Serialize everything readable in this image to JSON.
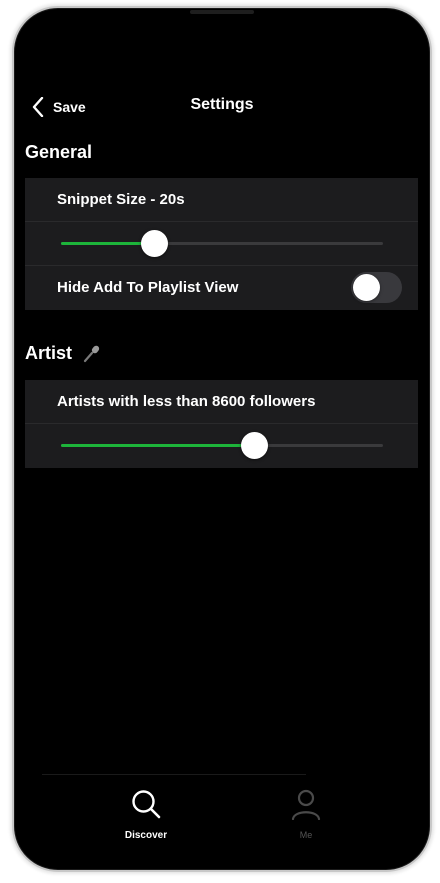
{
  "header": {
    "back_label": "Save",
    "title": "Settings"
  },
  "sections": {
    "general": {
      "title": "General",
      "snippet_size_label": "Snippet Size  -  20s",
      "snippet_slider_fraction": 0.29,
      "hide_playlist_label": "Hide Add To Playlist View",
      "hide_playlist_on": false
    },
    "artist": {
      "title": "Artist",
      "icon": "microphone-icon",
      "followers_label": "Artists with less than 8600 followers",
      "followers_slider_fraction": 0.6
    }
  },
  "tabbar": {
    "discover_label": "Discover",
    "me_label": "Me"
  },
  "colors": {
    "background": "#000000",
    "group_background": "#1c1c1e",
    "accent": "#1db43a",
    "toggle_off": "#39393d"
  }
}
